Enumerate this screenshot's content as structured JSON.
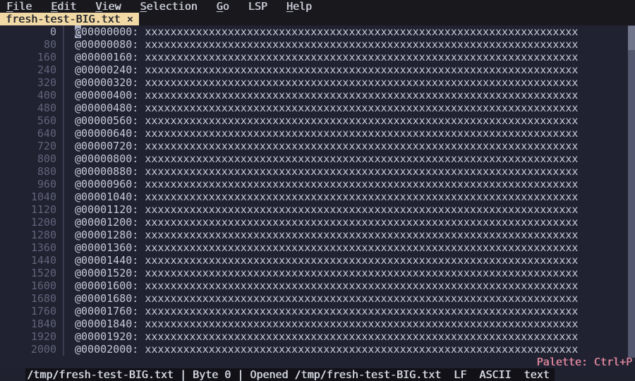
{
  "menu": {
    "items": [
      {
        "label": "File",
        "accel_underline": true
      },
      {
        "label": "Edit",
        "accel_underline": true
      },
      {
        "label": "View",
        "accel_underline": true
      },
      {
        "label": "Selection",
        "accel_underline": true
      },
      {
        "label": "Go",
        "accel_underline": true
      },
      {
        "label": "LSP",
        "accel_underline": false
      },
      {
        "label": "Help",
        "accel_underline": true
      }
    ]
  },
  "tab": {
    "label": "fresh-test-BIG.txt",
    "close_glyph": "×"
  },
  "editor": {
    "cursor_line_index": 0,
    "cursor_char": "@",
    "line_body": "xxxxxxxxxxxxxxxxxxxxxxxxxxxxxxxxxxxxxxxxxxxxxxxxxxxxxxxxxxxxxxxxxxxx",
    "lines": [
      {
        "num": "0",
        "addr": "@00000000:"
      },
      {
        "num": "80",
        "addr": "@00000080:"
      },
      {
        "num": "160",
        "addr": "@00000160:"
      },
      {
        "num": "240",
        "addr": "@00000240:"
      },
      {
        "num": "320",
        "addr": "@00000320:"
      },
      {
        "num": "400",
        "addr": "@00000400:"
      },
      {
        "num": "480",
        "addr": "@00000480:"
      },
      {
        "num": "560",
        "addr": "@00000560:"
      },
      {
        "num": "640",
        "addr": "@00000640:"
      },
      {
        "num": "720",
        "addr": "@00000720:"
      },
      {
        "num": "800",
        "addr": "@00000800:"
      },
      {
        "num": "880",
        "addr": "@00000880:"
      },
      {
        "num": "960",
        "addr": "@00000960:"
      },
      {
        "num": "1040",
        "addr": "@00001040:"
      },
      {
        "num": "1120",
        "addr": "@00001120:"
      },
      {
        "num": "1200",
        "addr": "@00001200:"
      },
      {
        "num": "1280",
        "addr": "@00001280:"
      },
      {
        "num": "1360",
        "addr": "@00001360:"
      },
      {
        "num": "1440",
        "addr": "@00001440:"
      },
      {
        "num": "1520",
        "addr": "@00001520:"
      },
      {
        "num": "1600",
        "addr": "@00001600:"
      },
      {
        "num": "1680",
        "addr": "@00001680:"
      },
      {
        "num": "1760",
        "addr": "@00001760:"
      },
      {
        "num": "1840",
        "addr": "@00001840:"
      },
      {
        "num": "1920",
        "addr": "@00001920:"
      },
      {
        "num": "2000",
        "addr": "@00002000:"
      }
    ]
  },
  "status": {
    "path": "/tmp/fresh-test-BIG.txt",
    "byte_label": "Byte 0",
    "opened_message": "Opened /tmp/fresh-test-BIG.txt",
    "separator": "|",
    "indicators": [
      "LF",
      "ASCII",
      "text"
    ],
    "palette_hint": "Palette: Ctrl+P"
  },
  "colors": {
    "editor_bg": "#212230",
    "bar_bg": "#18181e",
    "tab_bg": "#f0d9a4",
    "tab_text": "#23242c",
    "text": "#c4c8d7",
    "line_number": "#60657a",
    "line_number_current": "#a9aec3",
    "cursor_bg": "#abb1c8",
    "status_bg": "#121118",
    "palette_hint_text": "#d9849a",
    "scrollbar_track": "#53576e",
    "scrollbar_thumb": "#71768b"
  }
}
